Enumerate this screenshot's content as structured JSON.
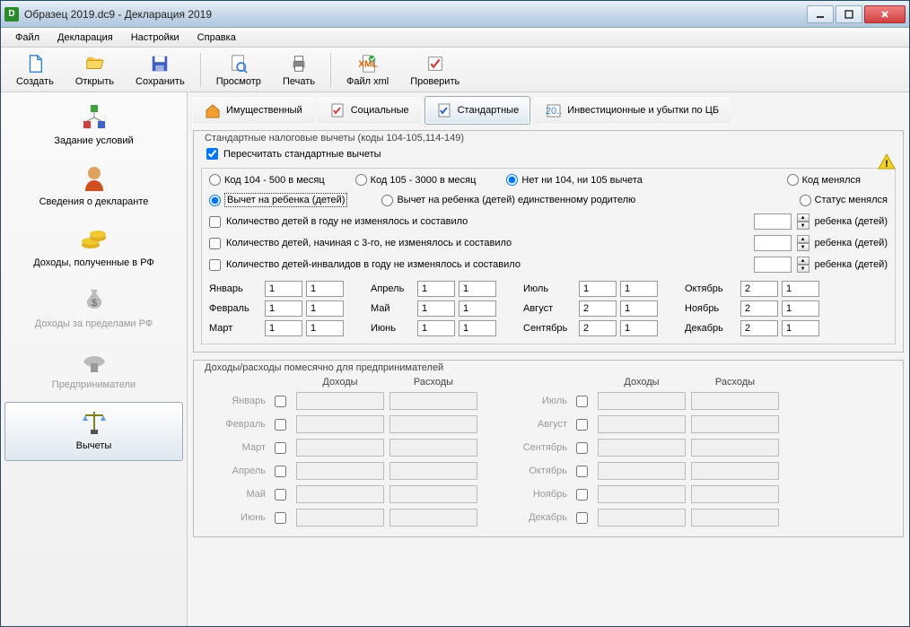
{
  "title": "Образец 2019.dc9 - Декларация 2019",
  "menu": {
    "file": "Файл",
    "decl": "Декларация",
    "settings": "Настройки",
    "help": "Справка"
  },
  "toolbar": {
    "create": "Создать",
    "open": "Открыть",
    "save": "Сохранить",
    "preview": "Просмотр",
    "print": "Печать",
    "xml": "Файл xml",
    "check": "Проверить"
  },
  "sidebar": {
    "conditions": "Задание условий",
    "declarant": "Сведения о декларанте",
    "income_rf": "Доходы, полученные в РФ",
    "income_abroad": "Доходы за пределами РФ",
    "entrepreneurs": "Предприниматели",
    "deductions": "Вычеты"
  },
  "subtabs": {
    "property": "Имущественный",
    "social": "Социальные",
    "standard": "Стандартные",
    "invest": "Инвестиционные и убытки по ЦБ"
  },
  "standard_section": {
    "legend": "Стандартные налоговые вычеты (коды 104-105,114-149)",
    "recalc": "Пересчитать стандартные вычеты",
    "code104": "Код 104 - 500 в месяц",
    "code105": "Код 105 - 3000 в месяц",
    "none": "Нет ни 104, ни 105 вычета",
    "changed": "Код менялся",
    "child": "Вычет на ребенка (детей)",
    "child_single": "Вычет на ребенка (детей) единственному родителю",
    "status_changed": "Статус менялся",
    "count1": "Количество детей в году не изменялось и составило",
    "count2": "Количество детей, начиная с 3-го, не изменялось и составило",
    "count3": "Количество детей-инвалидов в году не изменялось и составило",
    "child_suffix": "ребенка (детей)",
    "months": {
      "jan": "Январь",
      "feb": "Февраль",
      "mar": "Март",
      "apr": "Апрель",
      "may": "Май",
      "jun": "Июнь",
      "jul": "Июль",
      "aug": "Август",
      "sep": "Сентябрь",
      "oct": "Октябрь",
      "nov": "Ноябрь",
      "dec": "Декабрь"
    },
    "values": {
      "jan": [
        "1",
        "1"
      ],
      "feb": [
        "1",
        "1"
      ],
      "mar": [
        "1",
        "1"
      ],
      "apr": [
        "1",
        "1"
      ],
      "may": [
        "1",
        "1"
      ],
      "jun": [
        "1",
        "1"
      ],
      "jul": [
        "1",
        "1"
      ],
      "aug": [
        "2",
        "1"
      ],
      "sep": [
        "2",
        "1"
      ],
      "oct": [
        "2",
        "1"
      ],
      "nov": [
        "2",
        "1"
      ],
      "dec": [
        "2",
        "1"
      ]
    }
  },
  "income_section": {
    "legend": "Доходы/расходы помесячно для предпринимателей",
    "income_hdr": "Доходы",
    "expense_hdr": "Расходы"
  }
}
